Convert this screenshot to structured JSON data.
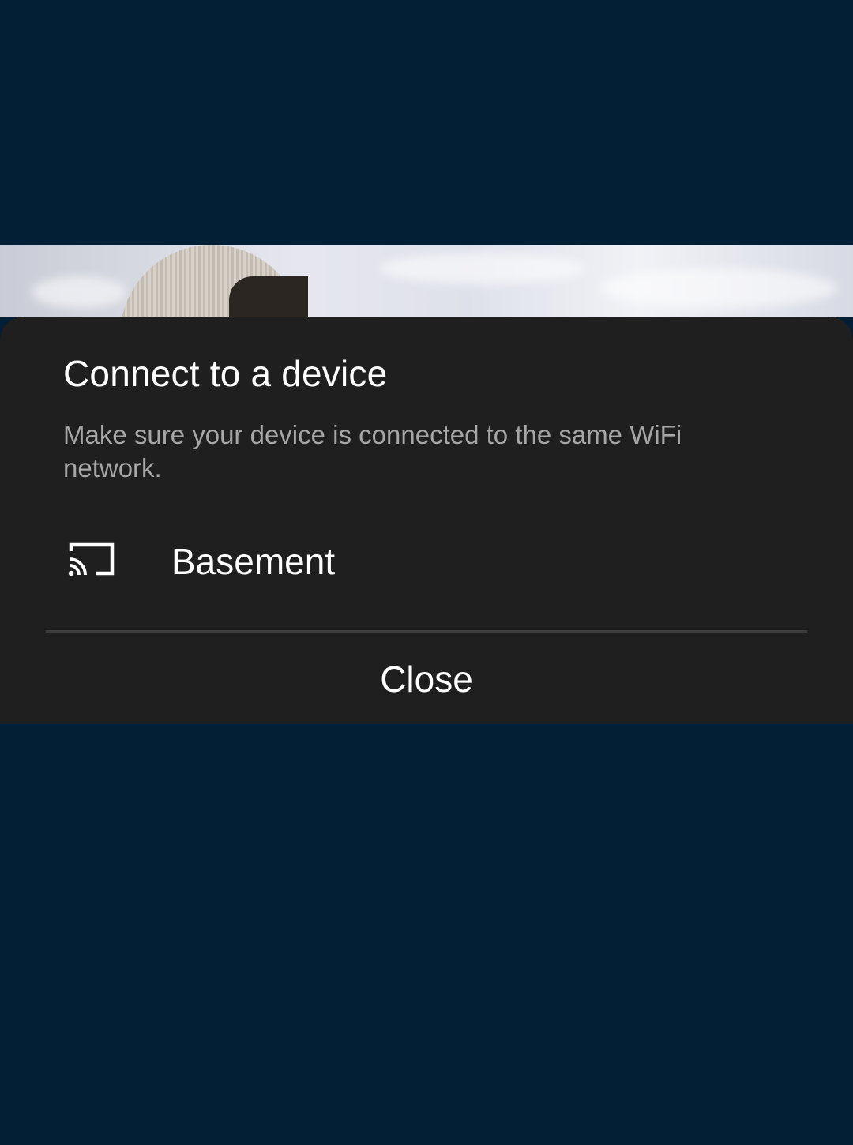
{
  "dialog": {
    "title": "Connect to a device",
    "subtitle": "Make sure your device is connected to the same WiFi network.",
    "devices": [
      {
        "name": "Basement",
        "icon": "cast-icon"
      }
    ],
    "close_label": "Close"
  },
  "colors": {
    "background": "#031f35",
    "sheet": "#1f1f1f",
    "title_text": "#ffffff",
    "subtitle_text": "#a6a6a6",
    "divider": "#3d3d3d"
  }
}
